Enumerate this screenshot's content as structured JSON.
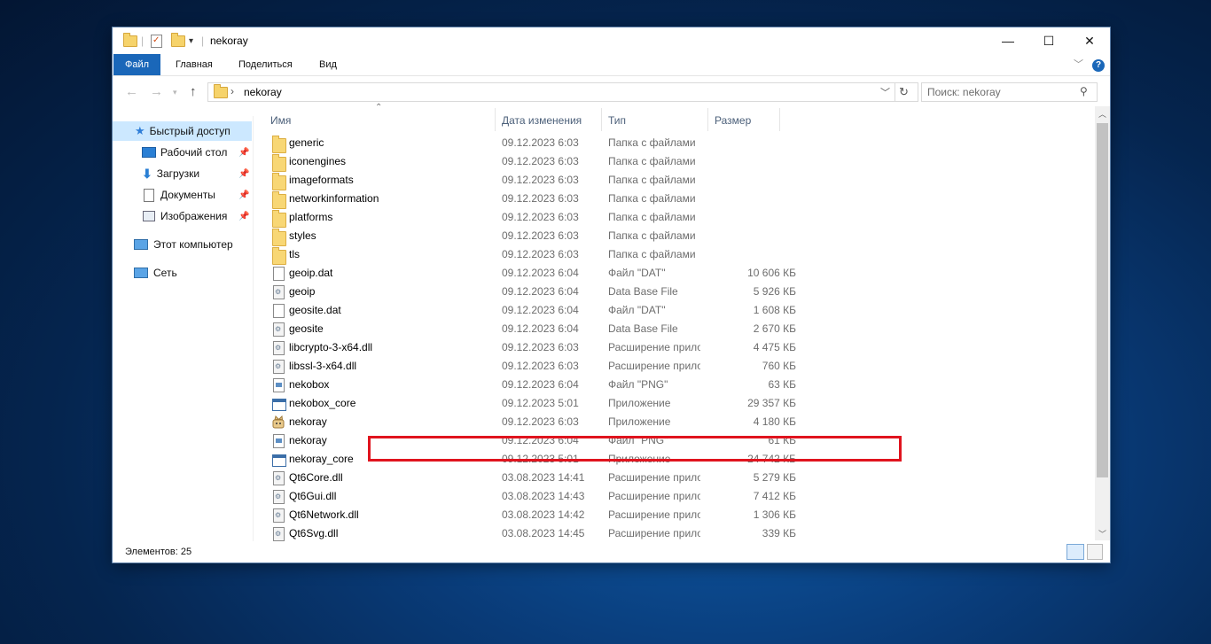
{
  "window": {
    "title": "nekoray",
    "controls": {
      "minimize": "—",
      "maximize": "☐",
      "close": "✕"
    }
  },
  "ribbon": {
    "tabs": [
      "Файл",
      "Главная",
      "Поделиться",
      "Вид"
    ],
    "help": "?"
  },
  "address": {
    "path": "nekoray",
    "search_placeholder": "Поиск: nekoray"
  },
  "sidebar": {
    "quick_access": "Быстрый доступ",
    "items": [
      {
        "label": "Рабочий стол",
        "icon": "desktop-icon",
        "pinned": true
      },
      {
        "label": "Загрузки",
        "icon": "downloads-icon",
        "pinned": true
      },
      {
        "label": "Документы",
        "icon": "documents-icon",
        "pinned": true
      },
      {
        "label": "Изображения",
        "icon": "pictures-icon",
        "pinned": true
      }
    ],
    "this_pc": "Этот компьютер",
    "network": "Сеть"
  },
  "columns": {
    "name": "Имя",
    "date": "Дата изменения",
    "type": "Тип",
    "size": "Размер"
  },
  "files": [
    {
      "name": "generic",
      "date": "09.12.2023 6:03",
      "type": "Папка с файлами",
      "size": "",
      "icon": "folder"
    },
    {
      "name": "iconengines",
      "date": "09.12.2023 6:03",
      "type": "Папка с файлами",
      "size": "",
      "icon": "folder"
    },
    {
      "name": "imageformats",
      "date": "09.12.2023 6:03",
      "type": "Папка с файлами",
      "size": "",
      "icon": "folder"
    },
    {
      "name": "networkinformation",
      "date": "09.12.2023 6:03",
      "type": "Папка с файлами",
      "size": "",
      "icon": "folder"
    },
    {
      "name": "platforms",
      "date": "09.12.2023 6:03",
      "type": "Папка с файлами",
      "size": "",
      "icon": "folder"
    },
    {
      "name": "styles",
      "date": "09.12.2023 6:03",
      "type": "Папка с файлами",
      "size": "",
      "icon": "folder"
    },
    {
      "name": "tls",
      "date": "09.12.2023 6:03",
      "type": "Папка с файлами",
      "size": "",
      "icon": "folder"
    },
    {
      "name": "geoip.dat",
      "date": "09.12.2023 6:04",
      "type": "Файл \"DAT\"",
      "size": "10 606 КБ",
      "icon": "doc"
    },
    {
      "name": "geoip",
      "date": "09.12.2023 6:04",
      "type": "Data Base File",
      "size": "5 926 КБ",
      "icon": "dll"
    },
    {
      "name": "geosite.dat",
      "date": "09.12.2023 6:04",
      "type": "Файл \"DAT\"",
      "size": "1 608 КБ",
      "icon": "doc"
    },
    {
      "name": "geosite",
      "date": "09.12.2023 6:04",
      "type": "Data Base File",
      "size": "2 670 КБ",
      "icon": "dll"
    },
    {
      "name": "libcrypto-3-x64.dll",
      "date": "09.12.2023 6:03",
      "type": "Расширение приложения",
      "size": "4 475 КБ",
      "icon": "dll"
    },
    {
      "name": "libssl-3-x64.dll",
      "date": "09.12.2023 6:03",
      "type": "Расширение приложения",
      "size": "760 КБ",
      "icon": "dll"
    },
    {
      "name": "nekobox",
      "date": "09.12.2023 6:04",
      "type": "Файл \"PNG\"",
      "size": "63 КБ",
      "icon": "png"
    },
    {
      "name": "nekobox_core",
      "date": "09.12.2023 5:01",
      "type": "Приложение",
      "size": "29 357 КБ",
      "icon": "exe"
    },
    {
      "name": "nekoray",
      "date": "09.12.2023 6:03",
      "type": "Приложение",
      "size": "4 180 КБ",
      "icon": "app"
    },
    {
      "name": "nekoray",
      "date": "09.12.2023 6:04",
      "type": "Файл \"PNG\"",
      "size": "61 КБ",
      "icon": "png"
    },
    {
      "name": "nekoray_core",
      "date": "09.12.2023 5:01",
      "type": "Приложение",
      "size": "24 742 КБ",
      "icon": "exe"
    },
    {
      "name": "Qt6Core.dll",
      "date": "03.08.2023 14:41",
      "type": "Расширение приложения",
      "size": "5 279 КБ",
      "icon": "dll"
    },
    {
      "name": "Qt6Gui.dll",
      "date": "03.08.2023 14:43",
      "type": "Расширение приложения",
      "size": "7 412 КБ",
      "icon": "dll"
    },
    {
      "name": "Qt6Network.dll",
      "date": "03.08.2023 14:42",
      "type": "Расширение приложения",
      "size": "1 306 КБ",
      "icon": "dll"
    },
    {
      "name": "Qt6Svg.dll",
      "date": "03.08.2023 14:45",
      "type": "Расширение приложения",
      "size": "339 КБ",
      "icon": "dll"
    }
  ],
  "status": {
    "count": "Элементов: 25"
  },
  "colors": {
    "accent": "#1a67b9",
    "selection": "#cce8ff",
    "highlight_box": "#e0141e"
  }
}
